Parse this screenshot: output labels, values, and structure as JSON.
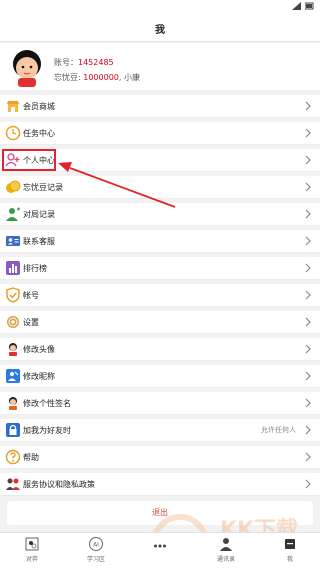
{
  "nav": {
    "title": "我"
  },
  "profile": {
    "account_label": "账号：",
    "account_value": "1452485",
    "beans_label": "忘忧豆: ",
    "beans_value": "1000000",
    "beans_suffix": ", 小康"
  },
  "menu": [
    {
      "label": "会员商城",
      "icon": "shop-icon"
    },
    {
      "label": "任务中心",
      "icon": "clock-icon"
    },
    {
      "label": "个人中心",
      "icon": "user-add-icon"
    },
    {
      "label": "忘忧豆记录",
      "icon": "coins-icon"
    },
    {
      "label": "对局记录",
      "icon": "user-icon"
    },
    {
      "label": "联系客服",
      "icon": "contact-card-icon"
    },
    {
      "label": "排行榜",
      "icon": "ranking-icon"
    },
    {
      "label": "帐号",
      "icon": "shield-icon"
    },
    {
      "label": "设置",
      "icon": "gear-icon"
    },
    {
      "label": "修改头像",
      "icon": "avatar-edit-icon"
    },
    {
      "label": "修改昵称",
      "icon": "edit-icon"
    },
    {
      "label": "修改个性签名",
      "icon": "signature-icon"
    },
    {
      "label": "加我为好友时",
      "icon": "lock-icon",
      "value": "允许任何人"
    },
    {
      "label": "帮助",
      "icon": "help-icon"
    },
    {
      "label": "服务协议和隐私政策",
      "icon": "agreement-icon"
    }
  ],
  "logout": {
    "label": "退出"
  },
  "tabs": [
    {
      "label": "对弈",
      "icon": "board-icon"
    },
    {
      "label": "学习区",
      "icon": "ai-icon"
    },
    {
      "label": "",
      "icon": "more-icon"
    },
    {
      "label": "通讯录",
      "icon": "contacts-icon"
    },
    {
      "label": "我",
      "icon": "profile-icon"
    }
  ],
  "colors": {
    "accent": "#d0021b",
    "highlight": "#e0242b",
    "logout": "#d94a3a"
  },
  "watermark": {
    "text": "KK下载",
    "url": "www.kkx.net"
  }
}
